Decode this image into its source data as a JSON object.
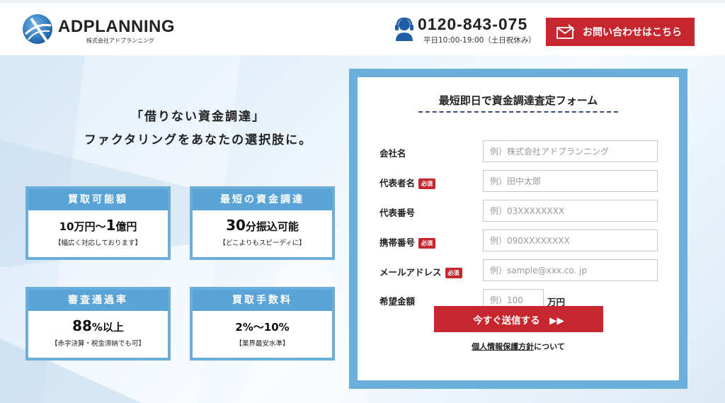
{
  "header": {
    "logo_name": "ADPLANNING",
    "logo_sub": "株式会社アドプランニング",
    "phone_number": "0120-843-075",
    "phone_hours": "平日10:00-19:00（土日祝休み）",
    "contact_button": "お問い合わせはこちら"
  },
  "hero": {
    "tagline_line1": "「借りない資金調達」",
    "tagline_line2": "ファクタリングをあなたの選択肢に。",
    "cards": [
      {
        "title": "買取可能額",
        "main_prefix": "10万円～",
        "main_big": "1",
        "main_suffix": "億円",
        "sub": "【幅広く対応しております】"
      },
      {
        "title": "最短の資金調達",
        "main_prefix": "",
        "main_big": "30",
        "main_suffix": "分振込可能",
        "sub": "【どこよりもスピーディに】"
      },
      {
        "title": "審査通過率",
        "main_prefix": "",
        "main_big": "88",
        "main_suffix": "%以上",
        "sub": "【赤字決算・税金滞納でも可】"
      },
      {
        "title": "買取手数料",
        "main_prefix": "2%～10%",
        "main_big": "",
        "main_suffix": "",
        "sub": "【業界最安水準】"
      }
    ]
  },
  "form": {
    "title": "最短即日で資金調達査定フォーム",
    "required_badge": "必須",
    "fields": [
      {
        "label": "会社名",
        "placeholder": "例）株式会社アドプランニング"
      },
      {
        "label": "代表者名",
        "placeholder": "例）田中太郎"
      },
      {
        "label": "代表番号",
        "placeholder": "例）03XXXXXXXX"
      },
      {
        "label": "携帯番号",
        "placeholder": "例）090XXXXXXXX"
      },
      {
        "label": "メールアドレス",
        "placeholder": "例）sample@xxx.co. jp"
      },
      {
        "label": "希望金額",
        "placeholder": "例）100"
      }
    ],
    "amount_unit": "万円",
    "submit_label": "今すぐ送信する　▶▶",
    "privacy_link": "個人情報保護方針",
    "privacy_suffix": "について"
  },
  "colors": {
    "accent_red": "#c6272f",
    "accent_blue": "#5aa3d6"
  },
  "icons": [
    "globe-logo-icon",
    "headset-icon",
    "mail-icon"
  ]
}
